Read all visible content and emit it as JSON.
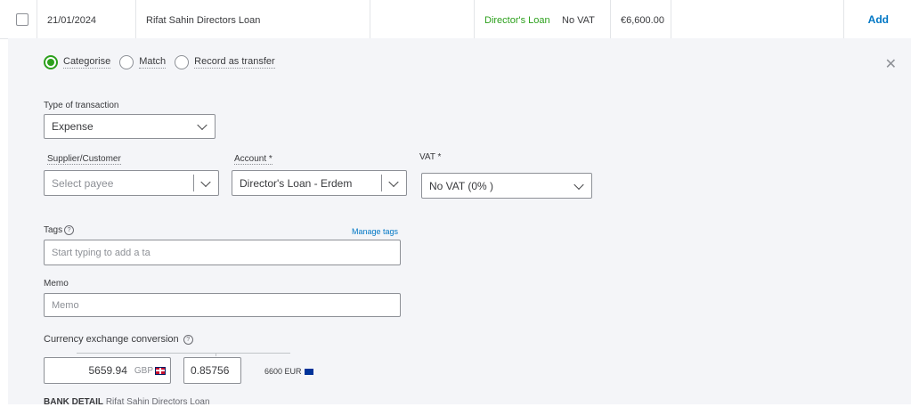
{
  "row": {
    "date": "21/01/2024",
    "description": "Rifat Sahin Directors Loan",
    "category": "Director's Loan",
    "vat": "No VAT",
    "amount": "€6,600.00",
    "action": "Add"
  },
  "modes": [
    "Categorise",
    "Match",
    "Record as transfer"
  ],
  "form": {
    "type_label": "Type of transaction",
    "type_value": "Expense",
    "payee_label": "Supplier/Customer",
    "payee_placeholder": "Select payee",
    "account_label": "Account *",
    "account_value": "Director's Loan - Erdem",
    "vat_label": "VAT *",
    "vat_value": "No VAT (0% )",
    "tags_label": "Tags",
    "manage_tags": "Manage tags",
    "tags_placeholder": "Start typing to add a ta",
    "memo_label": "Memo",
    "memo_placeholder": "Memo",
    "currency_label": "Currency exchange conversion",
    "gbp_amount": "5659.94",
    "gbp_code": "GBP",
    "rate": "0.85756",
    "eur_text": "6600 EUR",
    "bank_detail_label": "BANK DETAIL",
    "bank_detail_value": "Rifat Sahin Directors Loan"
  }
}
